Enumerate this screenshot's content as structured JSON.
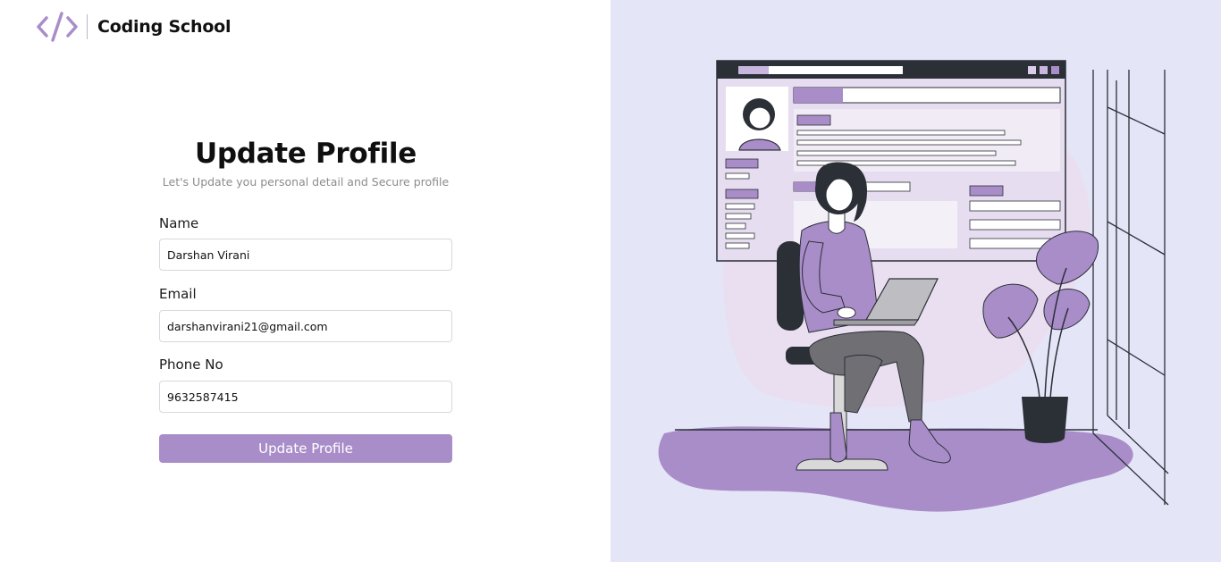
{
  "brand": {
    "name": "Coding School",
    "logo_icon": "code-brackets-icon",
    "accent": "#a98dc9"
  },
  "form": {
    "title": "Update Profile",
    "subtitle": "Let's Update you personal detail and Secure profile",
    "fields": [
      {
        "label": "Name",
        "value": "Darshan Virani"
      },
      {
        "label": "Email",
        "value": "darshanvirani21@gmail.com"
      },
      {
        "label": "Phone No",
        "value": "9632587415"
      }
    ],
    "submit_label": "Update Profile"
  },
  "illustration": {
    "description_icon": "woman-laptop-illustration",
    "background": "#e5e5f8"
  }
}
